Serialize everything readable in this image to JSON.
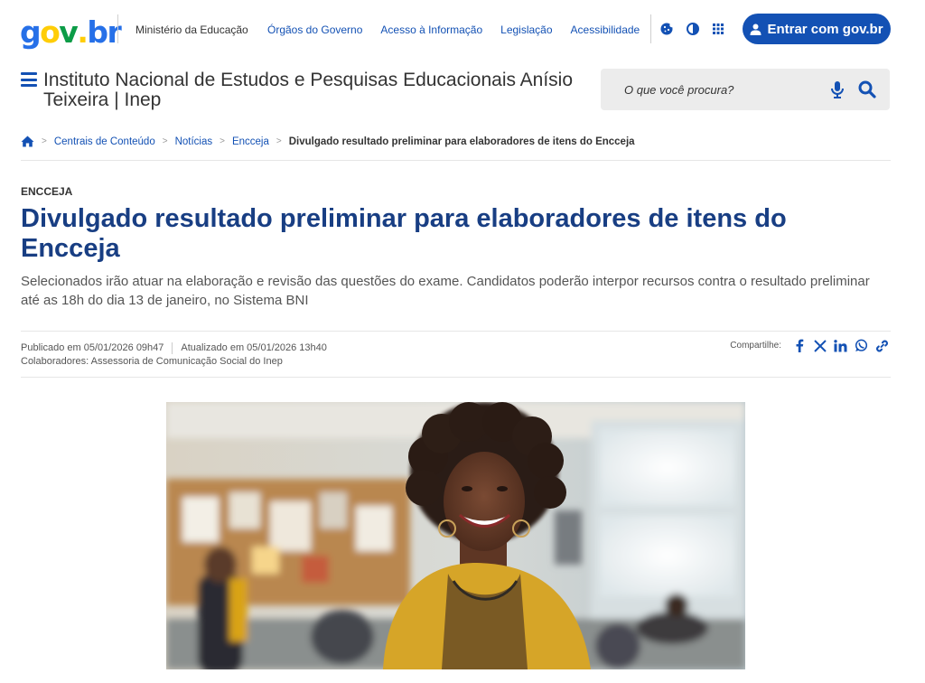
{
  "topbar": {
    "logo": {
      "g": "g",
      "o": "o",
      "v": "v",
      "dot": ".",
      "b": "b",
      "r": "r"
    },
    "ministerio": "Ministério da Educação",
    "links": [
      "Órgãos do Governo",
      "Acesso à Informação",
      "Legislação",
      "Acessibilidade"
    ],
    "login_label": "Entrar com gov.br",
    "colors": {
      "primary": "#1351b4",
      "logo_blue": "#2670e8",
      "logo_yellow": "#ffcd07",
      "logo_green": "#0c9c47",
      "title_blue": "#183e83"
    },
    "icons": [
      "cookie-icon",
      "contrast-icon",
      "apps-grid-icon",
      "user-icon"
    ]
  },
  "header": {
    "site_title": "Instituto Nacional de Estudos e Pesquisas Educacionais Anísio Teixeira | Inep",
    "search_placeholder": "O que você procura?"
  },
  "breadcrumb": {
    "items": [
      "Centrais de Conteúdo",
      "Notícias",
      "Encceja"
    ],
    "current": "Divulgado resultado preliminar para elaboradores de itens do Encceja"
  },
  "article": {
    "category": "ENCCEJA",
    "title": "Divulgado resultado preliminar para elaboradores de itens do Encceja",
    "subtitle": "Selecionados irão atuar na elaboração e revisão das questões do exame. Candidatos poderão interpor recursos contra o resultado preliminar até as 18h do dia 13 de janeiro, no Sistema BNI",
    "published": "Publicado em 05/01/2026 09h47",
    "updated": "Atualizado em 05/01/2026 13h40",
    "collaborators": "Colaboradores: Assessoria de Comunicação Social do Inep",
    "share_label": "Compartilhe:",
    "share_icons": [
      "facebook-icon",
      "x-icon",
      "linkedin-icon",
      "whatsapp-icon",
      "link-icon"
    ]
  }
}
